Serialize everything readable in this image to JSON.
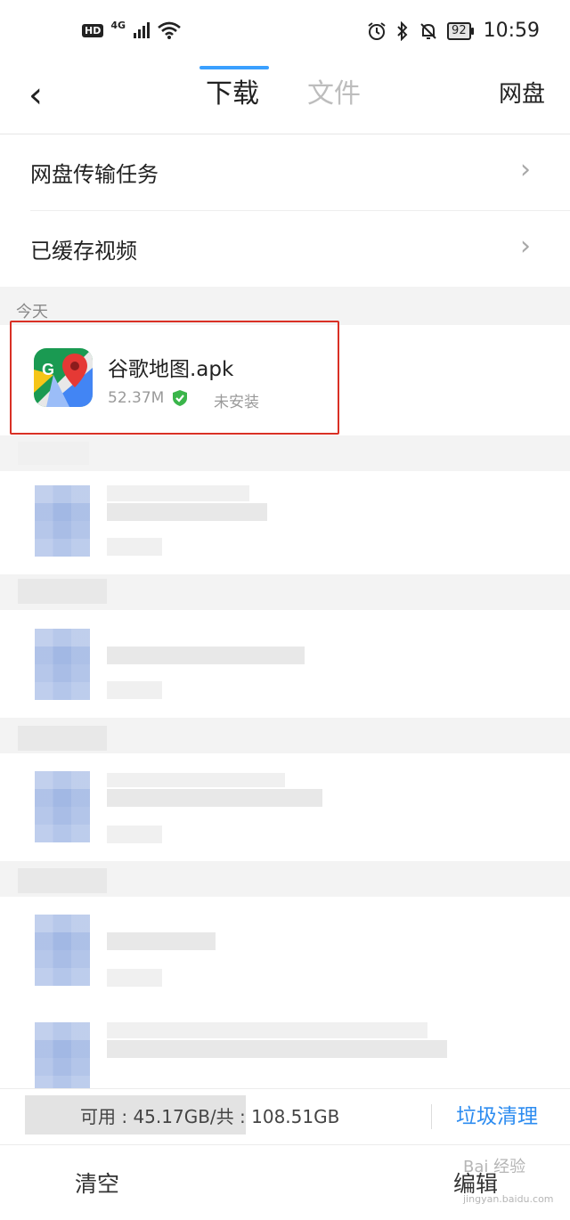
{
  "status_bar": {
    "badge": "HD",
    "network": "4G",
    "battery_level": "92",
    "time": "10:59"
  },
  "header": {
    "back_label": "‹",
    "tabs": [
      {
        "label": "下载",
        "active": true
      },
      {
        "label": "文件",
        "active": false
      }
    ],
    "right_button": "网盘"
  },
  "menu": {
    "items": [
      {
        "label": "网盘传输任务",
        "chevron": "›"
      },
      {
        "label": "已缓存视频",
        "chevron": "›"
      }
    ]
  },
  "section_today": {
    "label": "今天",
    "item": {
      "name": "谷歌地图.apk",
      "size": "52.37M",
      "status": "未安装",
      "icon": "google-maps-icon",
      "verified_icon": "shield-check-icon"
    }
  },
  "storage": {
    "text": "可用 : 45.17GB/共 : 108.51GB",
    "clean_label": "垃圾清理"
  },
  "bottom": {
    "clear_label": "清空",
    "edit_label": "编辑"
  },
  "watermark": {
    "text": "Bai 经验",
    "sub": "jingyan.baidu.com"
  },
  "colors": {
    "accent": "#2d8cf0",
    "tab_indicator": "#3aa0ff",
    "highlight": "#d93025",
    "verified": "#3ab54a"
  }
}
